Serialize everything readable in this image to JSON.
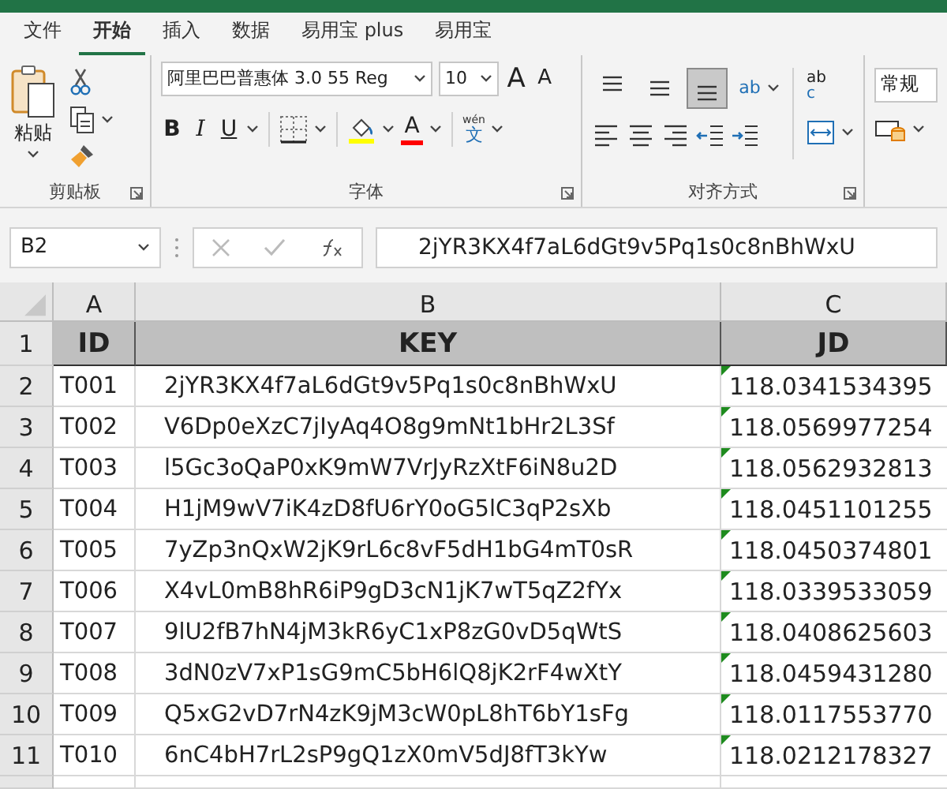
{
  "tabs": [
    {
      "label": "文件",
      "selected": false
    },
    {
      "label": "开始",
      "selected": true
    },
    {
      "label": "插入",
      "selected": false
    },
    {
      "label": "数据",
      "selected": false
    },
    {
      "label": "易用宝 plus",
      "selected": false
    },
    {
      "label": "易用宝",
      "selected": false
    }
  ],
  "clipboard": {
    "paste_label": "粘贴",
    "group_label": "剪贴板"
  },
  "font": {
    "name": "阿里巴巴普惠体 3.0 55 Reg",
    "size": "10",
    "grow_label": "A",
    "shrink_label": "A",
    "bold_label": "B",
    "italic_label": "I",
    "underline_label": "U",
    "color_label": "A",
    "phonetic_top": "wén",
    "phonetic_bottom": "文",
    "group_label": "字体"
  },
  "alignment": {
    "vertical": [
      {
        "kind": "top",
        "selected": false
      },
      {
        "kind": "middle",
        "selected": false
      },
      {
        "kind": "bottom",
        "selected": true
      }
    ],
    "orientation_label": "ab",
    "wrap_top": "ab",
    "wrap_bottom": "c",
    "group_label": "对齐方式"
  },
  "number": {
    "format": "常规"
  },
  "formula_bar": {
    "name_box": "B2",
    "value": "2jYR3KX4f7aL6dGt9v5Pq1s0c8nBhWxU"
  },
  "sheet": {
    "columns": [
      "A",
      "B",
      "C"
    ],
    "header": {
      "number": "1",
      "cells": [
        "ID",
        "KEY",
        "JD"
      ]
    },
    "rows": [
      {
        "number": "2",
        "id": "T001",
        "key": "2jYR3KX4f7aL6dGt9v5Pq1s0c8nBhWxU",
        "jd": "118.0341534395",
        "flagged": true
      },
      {
        "number": "3",
        "id": "T002",
        "key": "V6Dp0eXzC7jIyAq4O8g9mNt1bHr2L3Sf",
        "jd": "118.0569977254",
        "flagged": true
      },
      {
        "number": "4",
        "id": "T003",
        "key": "l5Gc3oQaP0xK9mW7VrJyRzXtF6iN8u2D",
        "jd": "118.0562932813",
        "flagged": true
      },
      {
        "number": "5",
        "id": "T004",
        "key": "H1jM9wV7iK4zD8fU6rY0oG5lC3qP2sXb",
        "jd": "118.0451101255",
        "flagged": true
      },
      {
        "number": "6",
        "id": "T005",
        "key": "7yZp3nQxW2jK9rL6c8vF5dH1bG4mT0sR",
        "jd": "118.0450374801",
        "flagged": true
      },
      {
        "number": "7",
        "id": "T006",
        "key": "X4vL0mB8hR6iP9gD3cN1jK7wT5qZ2fYx",
        "jd": "118.0339533059",
        "flagged": true
      },
      {
        "number": "8",
        "id": "T007",
        "key": "9lU2fB7hN4jM3kR6yC1xP8zG0vD5qWtS",
        "jd": "118.0408625603",
        "flagged": true
      },
      {
        "number": "9",
        "id": "T008",
        "key": "3dN0zV7xP1sG9mC5bH6lQ8jK2rF4wXtY",
        "jd": "118.0459431280",
        "flagged": true
      },
      {
        "number": "10",
        "id": "T009",
        "key": "Q5xG2vD7rN4zK9jM3cW0pL8hT6bY1sFg",
        "jd": "118.0117553770",
        "flagged": true
      },
      {
        "number": "11",
        "id": "T010",
        "key": "6nC4bH7rL2sP9gQ1zX0mV5dJ8fT3kYw",
        "jd": "118.0212178327",
        "flagged": true
      }
    ]
  }
}
